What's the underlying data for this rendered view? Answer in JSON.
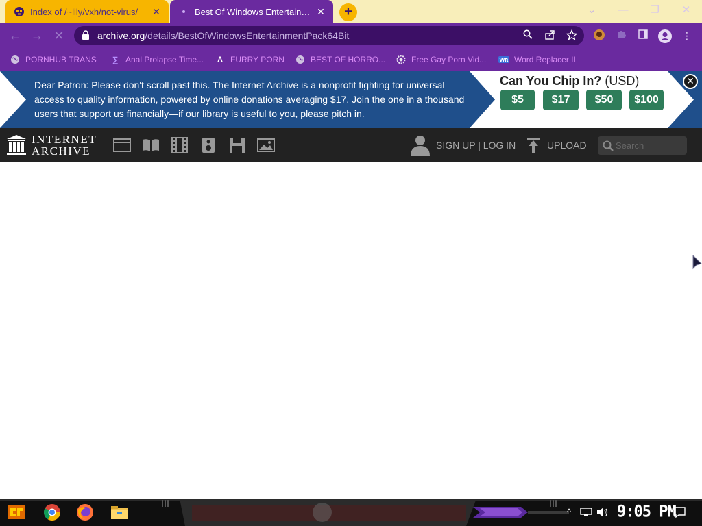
{
  "browser": {
    "tabs": [
      {
        "title": "Index of /~lily/vxh/not-virus/",
        "active": false
      },
      {
        "title": "Best Of Windows Entertainment Pack 64Bit",
        "active": true
      }
    ],
    "new_tab_label": "+",
    "close_glyph": "✕",
    "window_controls": {
      "dropdown": "⌄",
      "minimize": "—",
      "restore": "❐",
      "close": "✕"
    },
    "url": {
      "host": "archive.org",
      "path": "/details/BestOfWindowsEntertainmentPack64Bit"
    },
    "bookmarks": [
      {
        "label": "PORNHUB TRANS",
        "icon": "globe-icon"
      },
      {
        "label": "Anal Prolapse Time...",
        "icon": "sigma-icon"
      },
      {
        "label": "FURRY PORN",
        "icon": "a-logo-icon"
      },
      {
        "label": "BEST OF HORRO...",
        "icon": "globe-icon"
      },
      {
        "label": "Free Gay Porn Vid...",
        "icon": "gear-skull-icon"
      },
      {
        "label": "Word Replacer II",
        "icon": "wr-icon"
      }
    ],
    "theme": {
      "tabstrip": "#f8eeba",
      "active_tab": "#6a2a9f",
      "inactive_tab": "#f7b500",
      "toolbar": "#6a2a9f",
      "omnibox": "#3c0f66",
      "bookmark_text": "#d98cf5"
    }
  },
  "banner": {
    "message": "Dear Patron: Please don't scroll past this. The Internet Archive is a nonprofit fighting for universal access to quality information, powered by online donations averaging $17. Join the one in a thousand users that support us financially—if our library is useful to you, please pitch in.",
    "chip_title": "Can You Chip In?",
    "currency": "(USD)",
    "amounts": [
      "$5",
      "$17",
      "$50",
      "$100"
    ],
    "close_glyph": "✕",
    "colors": {
      "message_bg": "#1f4f8b",
      "button": "#2e7d5a"
    }
  },
  "ia_nav": {
    "logo_line1": "INTERNET",
    "logo_line2": "ARCHIVE",
    "media_icons": [
      "web-icon",
      "texts-icon",
      "video-icon",
      "audio-icon",
      "software-icon",
      "images-icon"
    ],
    "signup_login": "SIGN UP | LOG IN",
    "upload": "UPLOAD",
    "search_placeholder": "Search"
  },
  "taskbar": {
    "clock": "9:05 PM",
    "apps": [
      "start-icon",
      "chrome-icon",
      "firefox-icon",
      "file-explorer-icon"
    ],
    "tray_icons": [
      "chevron-up-icon",
      "network-icon",
      "volume-icon",
      "notifications-icon"
    ]
  }
}
